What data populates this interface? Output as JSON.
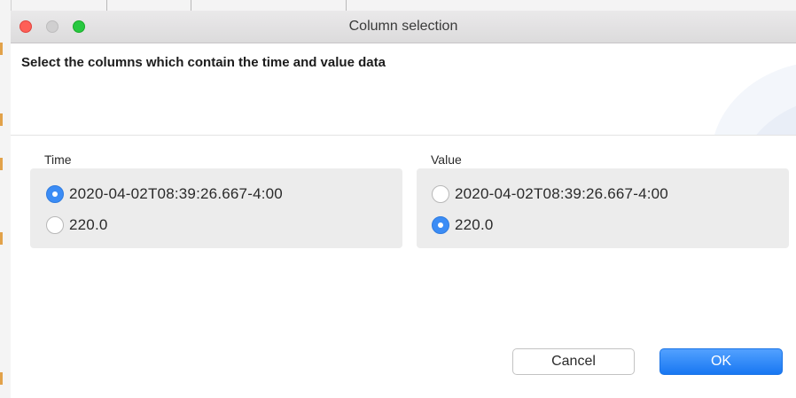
{
  "window": {
    "title": "Column selection"
  },
  "header": {
    "heading": "Select the columns which contain the time and value data"
  },
  "time_group": {
    "label": "Time",
    "options": [
      {
        "label": "2020-04-02T08:39:26.667-4:00",
        "selected": true
      },
      {
        "label": "220.0",
        "selected": false
      }
    ]
  },
  "value_group": {
    "label": "Value",
    "options": [
      {
        "label": "2020-04-02T08:39:26.667-4:00",
        "selected": false
      },
      {
        "label": "220.0",
        "selected": true
      }
    ]
  },
  "buttons": {
    "cancel": "Cancel",
    "ok": "OK"
  },
  "colors": {
    "accent": "#3b8cf5",
    "close": "#fe5f57",
    "maximize": "#27c840"
  }
}
